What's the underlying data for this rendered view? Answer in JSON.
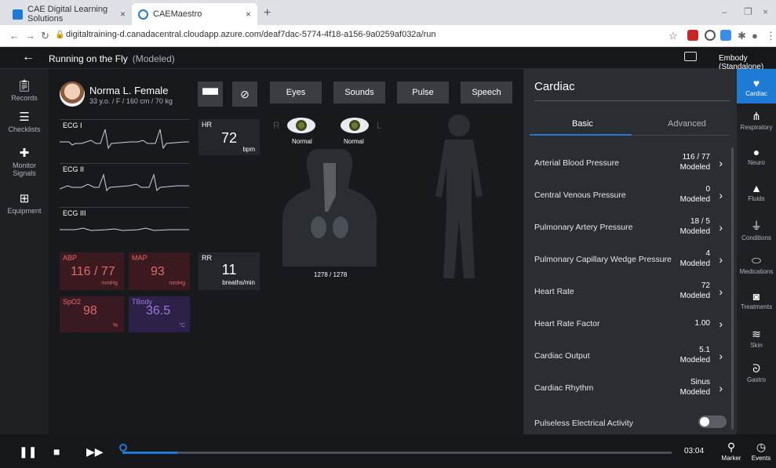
{
  "browser": {
    "tabs": [
      {
        "label": "CAE Digital Learning Solutions",
        "close": "×"
      },
      {
        "label": "CAEMaestro",
        "close": "×"
      }
    ],
    "new_tab": "+",
    "url": "digitaltraining-d.canadacentral.cloudapp.azure.com/deaf7dac-5774-4f18-a156-9a0259af032a/run",
    "window_controls": [
      "–",
      "❐",
      "×"
    ]
  },
  "header": {
    "title": "Running on the Fly",
    "subtitle": "(Modeled)",
    "mode": "Embody (Standalone)"
  },
  "left_nav": [
    {
      "label": "Records",
      "icon": "clipboard-icon"
    },
    {
      "label": "Checklists",
      "icon": "checklist-icon"
    },
    {
      "label": "Monitor Signals",
      "icon": "monitor-signals-icon"
    },
    {
      "label": "Equipment",
      "icon": "equipment-icon"
    }
  ],
  "patient": {
    "name": "Norma L. Female",
    "info": "33 y.o. / F / 160 cm / 70 kg"
  },
  "toolbar": {
    "buttons": [
      "Eyes",
      "Sounds",
      "Pulse",
      "Speech"
    ]
  },
  "ecg": [
    {
      "label": "ECG I"
    },
    {
      "label": "ECG II"
    },
    {
      "label": "ECG III"
    }
  ],
  "vitals": {
    "hr": {
      "label": "HR",
      "value": "72",
      "unit": "bpm"
    },
    "rr": {
      "label": "RR",
      "value": "11",
      "unit": "breaths/min"
    },
    "abp": {
      "label": "ABP",
      "value": "116 / 77",
      "unit": "mmHg"
    },
    "map": {
      "label": "MAP",
      "value": "93",
      "unit": "mmHg"
    },
    "spo2": {
      "label": "SpO2",
      "value": "98",
      "unit": "%"
    },
    "tbody": {
      "label": "TBody",
      "value": "36.5",
      "unit": "°C"
    }
  },
  "eyes": {
    "right_label": "R",
    "left_label": "L",
    "right_status": "Normal",
    "left_status": "Normal"
  },
  "breath_ratio": "1278 / 1278",
  "cardiac": {
    "title": "Cardiac",
    "tabs": [
      "Basic",
      "Advanced"
    ],
    "rows": [
      {
        "name": "Arterial Blood Pressure",
        "value": "116 / 77",
        "mode": "Modeled"
      },
      {
        "name": "Central Venous Pressure",
        "value": "0",
        "mode": "Modeled"
      },
      {
        "name": "Pulmonary Artery Pressure",
        "value": "18 / 5",
        "mode": "Modeled"
      },
      {
        "name": "Pulmonary Capillary Wedge Pressure",
        "value": "4",
        "mode": "Modeled"
      },
      {
        "name": "Heart Rate",
        "value": "72",
        "mode": "Modeled"
      },
      {
        "name": "Heart Rate Factor",
        "value": "1.00",
        "mode": ""
      },
      {
        "name": "Cardiac Output",
        "value": "5.1",
        "mode": "Modeled"
      },
      {
        "name": "Cardiac Rhythm",
        "value": "Sinus",
        "mode": "Modeled"
      },
      {
        "name": "Pulseless Electrical Activity",
        "value": "",
        "mode": ""
      }
    ]
  },
  "right_nav": [
    {
      "label": "Cardiac",
      "icon": "heart-icon"
    },
    {
      "label": "Respiratory",
      "icon": "lungs-icon"
    },
    {
      "label": "Neuro",
      "icon": "brain-icon"
    },
    {
      "label": "Fluids",
      "icon": "drop-icon"
    },
    {
      "label": "Conditions",
      "icon": "pulse-icon"
    },
    {
      "label": "Medications",
      "icon": "pill-icon"
    },
    {
      "label": "Treatments",
      "icon": "treatment-icon"
    },
    {
      "label": "Skin",
      "icon": "skin-icon"
    },
    {
      "label": "Gastro",
      "icon": "stomach-icon"
    }
  ],
  "playback": {
    "progress_fraction": 0.1,
    "time": "03:04",
    "marker_label": "Marker",
    "events_label": "Events"
  },
  "colors": {
    "accent": "#1f7ad6",
    "abp": "#e26a6a",
    "temp": "#9d77e0"
  }
}
